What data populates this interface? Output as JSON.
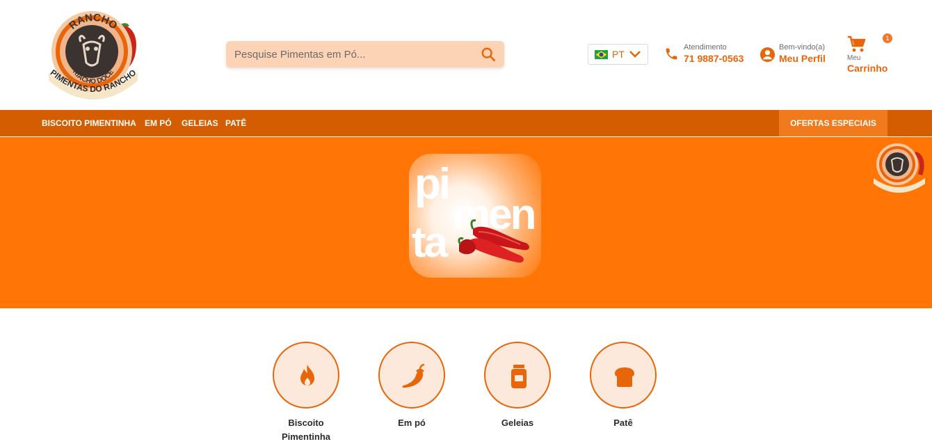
{
  "header": {
    "logo": {
      "icon": "rancho-riacho-doce-logo-icon",
      "top_text": "RANCHO",
      "mid_text": "RIACHO DOCE",
      "bottom_text": "PIMENTAS DO RANCHO"
    },
    "search": {
      "placeholder": "Pesquise Pimentas em Pó...",
      "icon": "search-icon"
    },
    "language": {
      "code": "PT",
      "icon": "brazil-flag-icon"
    },
    "contact": {
      "label": "Atendimento",
      "phone": "71 9887-0563",
      "icon": "phone-icon"
    },
    "profile": {
      "greeting": "Bem-vindo(a)",
      "label": "Meu Perfil",
      "icon": "user-icon"
    },
    "cart": {
      "prefix": "Meu",
      "label": "Carrinho",
      "count": "1",
      "icon": "cart-icon"
    }
  },
  "nav": {
    "items": [
      {
        "label": "BISCOITO PIMENTINHA"
      },
      {
        "label": "EM PÓ"
      },
      {
        "label": "GELEIAS"
      },
      {
        "label": "PATÊ"
      }
    ],
    "offers_label": "OFERTAS ESPECIAIS"
  },
  "banner": {
    "lines": [
      "pi",
      "men",
      "ta"
    ]
  },
  "categories": [
    {
      "label": "Biscoito Pimentinha",
      "icon": "flame-icon"
    },
    {
      "label": "Em pó",
      "icon": "chili-pepper-icon"
    },
    {
      "label": "Geleias",
      "icon": "jar-icon"
    },
    {
      "label": "Patê",
      "icon": "bread-icon"
    }
  ],
  "colors": {
    "accent": "#e8650a",
    "nav_bg": "#d35d00",
    "banner_bg": "#ff7607",
    "offers_bg": "#f07a1c",
    "search_bg": "#fdd3b5"
  }
}
